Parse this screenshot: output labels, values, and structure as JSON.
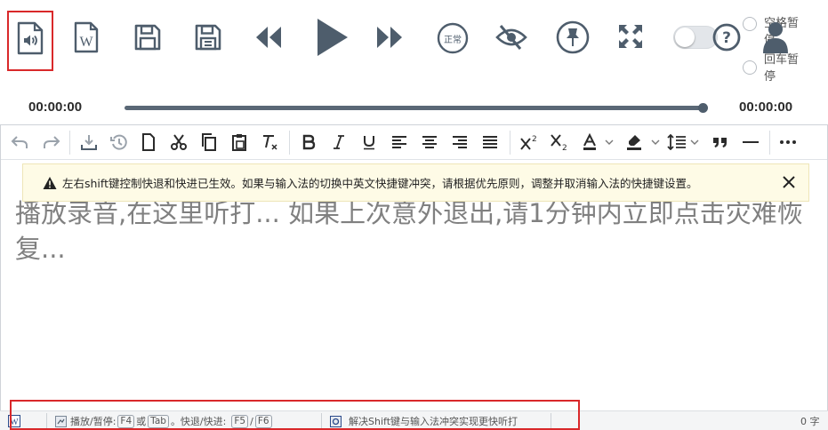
{
  "player": {
    "current_time": "00:00:00",
    "total_time": "00:00:00",
    "progress": 1.0,
    "speed_label": "正常",
    "toggle_on": false,
    "radio_space": "空格暂停",
    "radio_enter": "回车暂停",
    "icons": [
      "audio-file-icon",
      "word-doc-icon",
      "save-icon",
      "save-as-icon",
      "rewind-icon",
      "play-icon",
      "fast-forward-icon",
      "speed-normal-icon",
      "eye-slash-icon",
      "pin-icon",
      "fullscreen-icon",
      "help-icon",
      "user-icon"
    ]
  },
  "editor": {
    "notice": "左右shift键控制快退和快进已生效。如果与输入法的切换中英文快捷键冲突，请根据优先原则，调整并取消输入法的快捷键设置。",
    "placeholder": "播放录音,在这里听打... 如果上次意外退出,请1分钟内立即点击灾难恢复...",
    "toolbar_icons": [
      "undo-icon",
      "redo-icon",
      "download-icon",
      "history-icon",
      "new-doc-icon",
      "cut-icon",
      "copy-icon",
      "paste-icon",
      "clear-format-icon",
      "bold-icon",
      "italic-icon",
      "underline-icon",
      "align-left-icon",
      "align-center-icon",
      "align-right-icon",
      "justify-icon",
      "superscript-icon",
      "subscript-icon",
      "font-color-icon",
      "highlight-icon",
      "line-height-icon",
      "quote-icon",
      "horizontal-rule-icon",
      "more-icon"
    ]
  },
  "statusbar": {
    "play_pause_label": "播放/暂停:",
    "key_f4": "F4",
    "or_label": "或",
    "key_tab": "Tab",
    "back_forward_label": "。快退/快进:",
    "key_f5": "F5",
    "slash": "/",
    "key_f6": "F6",
    "fix_label": "解决Shift键与输入法冲突实现更快听打",
    "word_count": "0 字"
  },
  "colors": {
    "icon": "#4e5d6c",
    "highlight": "#d9282a",
    "notice_bg": "#fefbe6",
    "placeholder": "#808080"
  }
}
